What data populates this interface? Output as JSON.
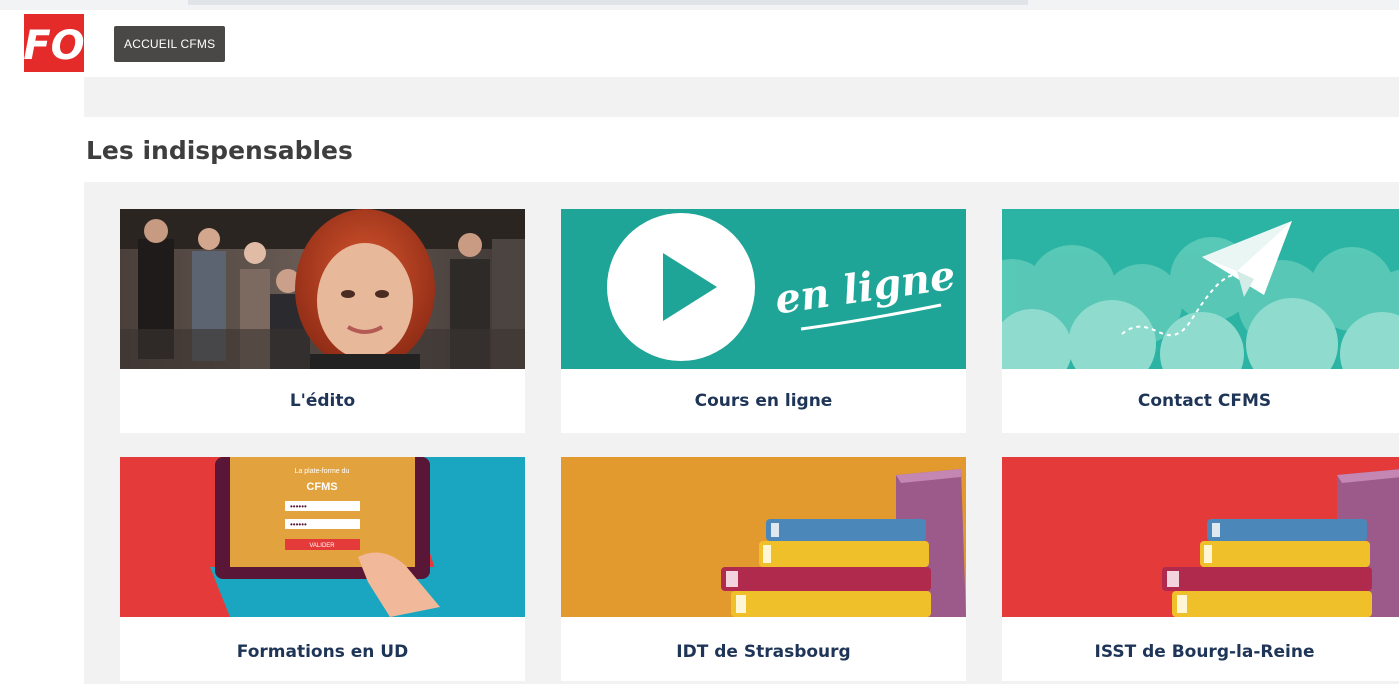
{
  "header": {
    "logo_text": "FO",
    "nav_button_label": "ACCUEIL CFMS"
  },
  "section": {
    "title": "Les indispensables"
  },
  "cards": [
    {
      "label": "L'édito"
    },
    {
      "label": "Cours en ligne",
      "image_text": "en ligne"
    },
    {
      "label": "Contact CFMS"
    },
    {
      "label": "Formations en UD",
      "image_text": {
        "line1": "La plate-forme du",
        "line2": "CFMS",
        "button": "VALIDER"
      }
    },
    {
      "label": "IDT de Strasbourg"
    },
    {
      "label": "ISST de Bourg-la-Reine"
    }
  ],
  "colors": {
    "brand_red": "#e52a2a",
    "teal": "#1ea597",
    "orange": "#e29a2f",
    "nav_dark": "#4a4747",
    "card_label": "#1f3558",
    "panel_grey": "#f2f2f3"
  }
}
